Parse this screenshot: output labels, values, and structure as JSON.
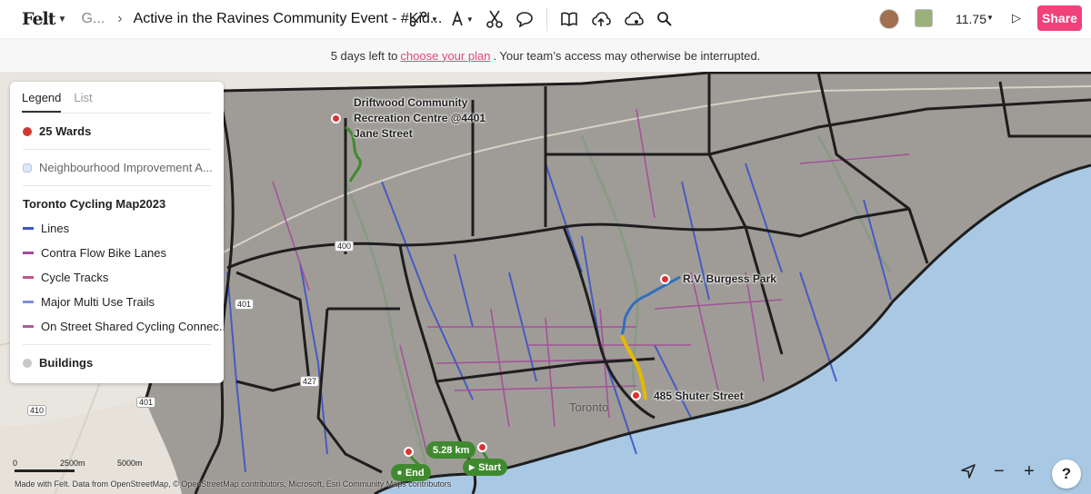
{
  "header": {
    "logo": "Felt",
    "breadcrumb": "G...",
    "separator": "›",
    "map_title": "Active in the Ravines Community Event - #Kid...",
    "zoom_level": "11.75",
    "share_label": "Share",
    "tools": [
      "route-icon",
      "text-icon",
      "scissors-icon",
      "comment-icon",
      "book-icon",
      "upload-icon",
      "cloud-icon",
      "search-icon"
    ]
  },
  "banner": {
    "prefix": "5 days left to",
    "link": "choose your plan",
    "suffix": ". Your team’s access may otherwise be interrupted."
  },
  "legend": {
    "tabs": [
      "Legend",
      "List"
    ],
    "items": [
      {
        "label": "25 Wards",
        "kind": "dot",
        "color": "#d03a32",
        "bold": true
      },
      {
        "label": "Neighbourhood Improvement A...",
        "kind": "square",
        "color": "#dde6f7",
        "muted": true
      },
      {
        "label": "Toronto Cycling Map2023",
        "kind": "heading"
      },
      {
        "label": "Lines",
        "kind": "line",
        "color": "#3b55c8"
      },
      {
        "label": "Contra Flow Bike Lanes",
        "kind": "line",
        "color": "#a44a9a"
      },
      {
        "label": "Cycle Tracks",
        "kind": "line",
        "color": "#c0558f"
      },
      {
        "label": "Major Multi Use Trails",
        "kind": "line",
        "color": "#7a8fe0"
      },
      {
        "label": "On Street Shared Cycling Connec...",
        "kind": "line",
        "color": "#b55a9a"
      },
      {
        "label": "Buildings",
        "kind": "dot",
        "color": "#c8c8c8",
        "bold": true
      }
    ]
  },
  "map": {
    "places": [
      {
        "label": "Driftwood Community\nRecreation Centre @4401\nJane Street"
      },
      {
        "label": "R.V. Burgess Park"
      },
      {
        "label": "485 Shuter Street"
      }
    ],
    "city_label": "Toronto",
    "highways": [
      "400",
      "401",
      "401",
      "410",
      "427"
    ],
    "route": {
      "distance": "5.28 km",
      "start": "Start",
      "end": "End"
    },
    "scale": {
      "ticks": [
        "0",
        "2500m",
        "5000m"
      ]
    },
    "attribution": "Made with Felt. Data from OpenStreetMap, © OpenStreetMap contributors, Microsoft, Esri Community Maps contributors",
    "controls": {
      "help": "?"
    }
  },
  "colors": {
    "accent": "#f0417a",
    "ward_border": "#1e1e1e",
    "trail": "#2f6fbf",
    "route_green": "#3f8a2e",
    "route_yellow": "#e6b800"
  }
}
